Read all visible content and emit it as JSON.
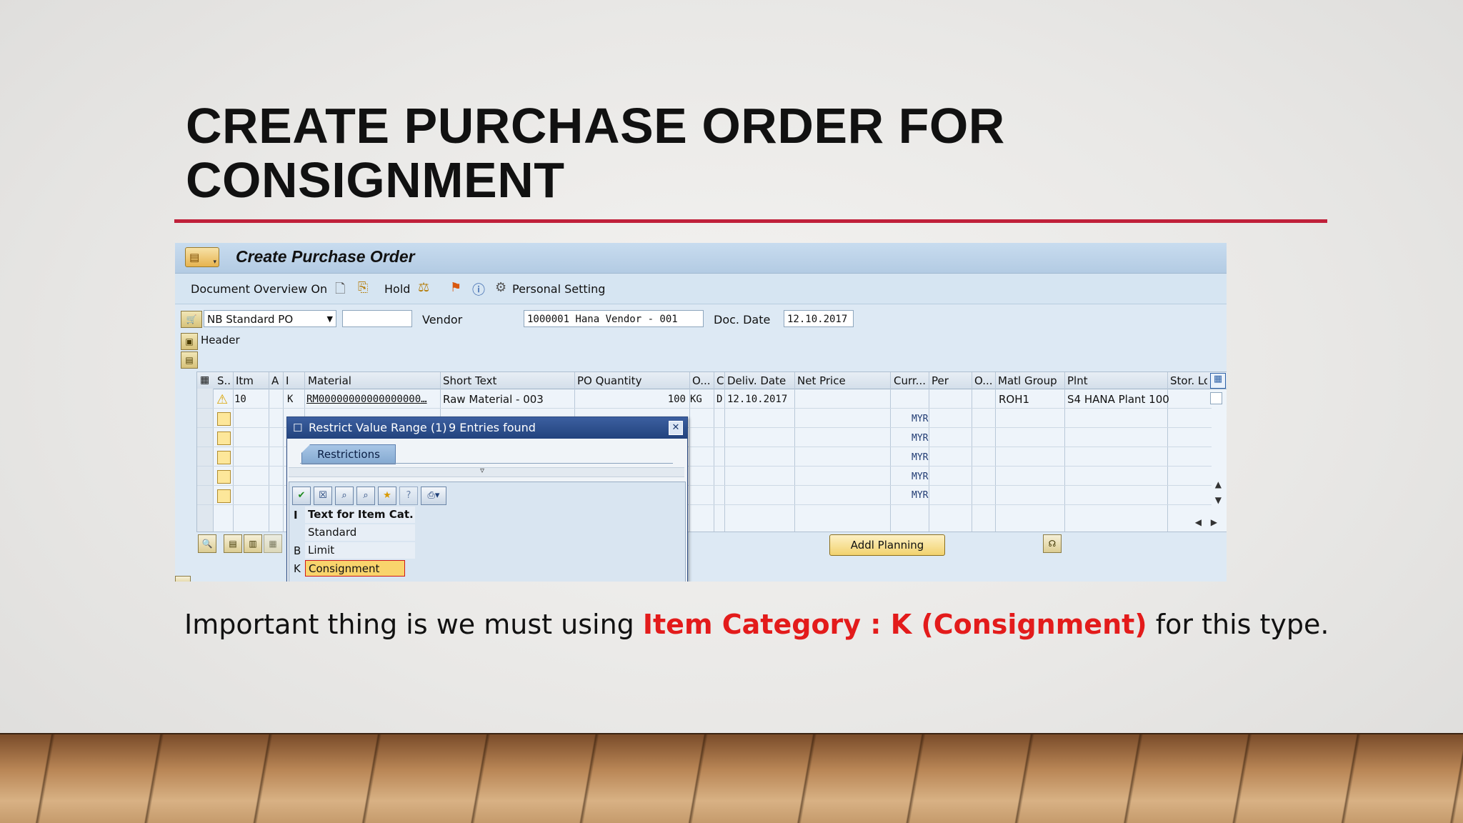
{
  "slide": {
    "title_line1": "CREATE PURCHASE ORDER FOR",
    "title_line2": "CONSIGNMENT",
    "caption_pre": "Important thing is we must using ",
    "caption_highlight": "Item Category : K (Consignment)",
    "caption_post": " for this type.",
    "accent_color": "#c0203a",
    "highlight_color": "#e31b1b"
  },
  "sap": {
    "window_title": "Create Purchase Order",
    "toolbar": {
      "document_overview": "Document Overview On",
      "hold": "Hold",
      "personal_setting": "Personal Setting"
    },
    "header_row": {
      "doc_type": "NB Standard PO",
      "doc_type_extra": "",
      "vendor_label": "Vendor",
      "vendor_value": "1000001 Hana Vendor - 001",
      "doc_date_label": "Doc. Date",
      "doc_date_value": "12.10.2017",
      "header_label": "Header"
    },
    "table": {
      "columns": [
        "S..",
        "Itm",
        "A",
        "I",
        "Material",
        "Short Text",
        "PO Quantity",
        "O...",
        "C",
        "Deliv. Date",
        "Net Price",
        "Curr...",
        "Per",
        "O...",
        "Matl Group",
        "Plnt",
        "Stor. Lo"
      ],
      "row1": {
        "itm": "10",
        "i": "K",
        "material": "RM00000000000000000…",
        "short_text": "Raw Material - 003",
        "po_quantity": "100",
        "unit": "KG",
        "c": "D",
        "deliv_date": "12.10.2017",
        "matl_group": "ROH1",
        "plant": "S4 HANA Plant 100"
      },
      "empty_currency": [
        "MYR",
        "MYR",
        "MYR",
        "MYR",
        "MYR"
      ]
    },
    "addl_planning": "Addl Planning"
  },
  "popup": {
    "title": "Restrict Value Range (1)",
    "entries": "9 Entries found",
    "tab": "Restrictions",
    "list_header_key": "I",
    "list_header_text": "Text for Item Cat.",
    "items": [
      {
        "key": "",
        "text": "Standard"
      },
      {
        "key": "B",
        "text": "Limit"
      },
      {
        "key": "K",
        "text": "Consignment"
      }
    ]
  }
}
